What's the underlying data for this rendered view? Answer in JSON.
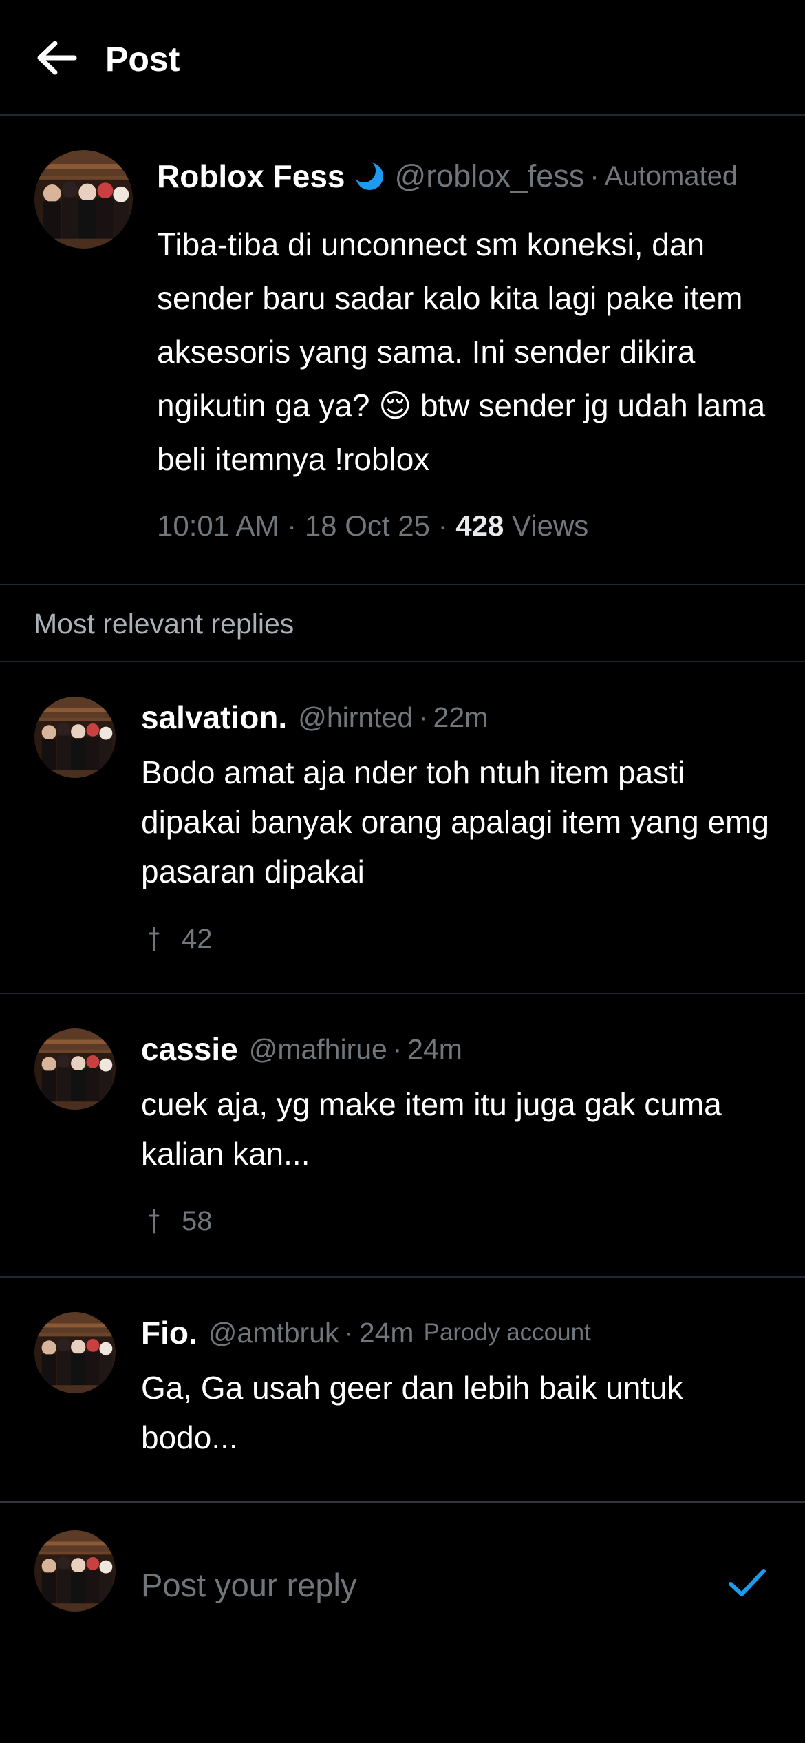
{
  "header": {
    "title": "Post",
    "back_icon": "arrow-left-icon"
  },
  "post": {
    "author_name": "Roblox Fess",
    "author_handle": "@roblox_fess",
    "separator": "·",
    "author_label": "Automated",
    "verified_icon": "crescent-moon-icon",
    "text": "Tiba-tiba di unconnect sm koneksi, dan sender baru sadar kalo kita lagi pake item aksesoris yang sama. Ini sender dikira ngikutin ga ya? 😌 btw sender jg udah lama beli itemnya !roblox",
    "time": "10:01 AM",
    "date": "18 Oct 25",
    "views_count": "428",
    "views_label": "Views"
  },
  "replies_section": {
    "label": "Most relevant replies"
  },
  "replies": [
    {
      "name": "salvation.",
      "handle": "@hirnted",
      "time": "22m",
      "label": "",
      "text": "Bodo amat aja nder toh ntuh item pasti dipakai banyak orang apalagi item yang emg pasaran dipakai",
      "stat_count": "42"
    },
    {
      "name": "cassie",
      "handle": "@mafhirue",
      "time": "24m",
      "label": "",
      "text": "cuek aja, yg make item itu juga gak cuma kalian kan...",
      "stat_count": "58"
    },
    {
      "name": "Fio.",
      "handle": "@amtbruk",
      "time": "24m",
      "label": "Parody account",
      "text": "Ga, Ga usah geer dan lebih baik untuk bodo...",
      "stat_count": ""
    }
  ],
  "composer": {
    "placeholder": "Post your reply",
    "send_icon": "checkmark-icon"
  },
  "colors": {
    "background": "#000000",
    "text_primary": "#ffffff",
    "text_secondary": "#71767b",
    "accent": "#1d9bf0",
    "divider": "#1f2933"
  }
}
